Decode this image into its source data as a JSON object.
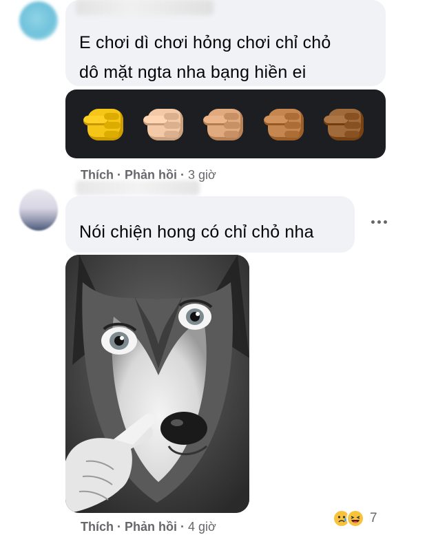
{
  "comments": [
    {
      "text_lines": [
        "E chơi dì chơi hỏng chơi chỉ chỏ",
        "dô mặt ngta nha bạng hiền ei"
      ],
      "actions": {
        "like": "Thích",
        "reply": "Phản hồi",
        "time": "3 giờ"
      },
      "attachment": {
        "type": "emoji-strip",
        "icon": "pointing-finger-icon",
        "tones": [
          "#f5c518",
          "#f3c9a8",
          "#e0a97e",
          "#c68650",
          "#a06a3b"
        ]
      }
    },
    {
      "text": "Nói chiện hong có chỉ chỏ nha",
      "actions": {
        "like": "Thích",
        "reply": "Phản hồi",
        "time": "4 giờ"
      },
      "attachment": {
        "type": "image",
        "subject": "husky-pointing-meme"
      },
      "reactions": {
        "icons": [
          "sad-reaction-icon",
          "haha-reaction-icon"
        ],
        "count": "7"
      }
    }
  ]
}
